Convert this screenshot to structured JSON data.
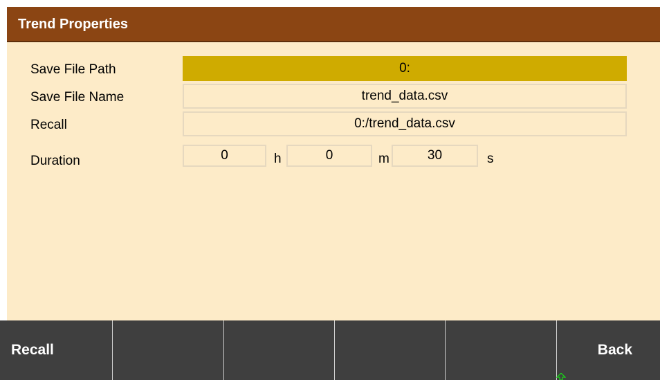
{
  "header": {
    "title": "Trend Properties"
  },
  "form": {
    "save_file_path": {
      "label": "Save File Path",
      "value": "0:"
    },
    "save_file_name": {
      "label": "Save File Name",
      "value": "trend_data.csv"
    },
    "recall": {
      "label": "Recall",
      "value": "0:/trend_data.csv"
    },
    "duration": {
      "label": "Duration",
      "hours": "0",
      "hours_unit": "h",
      "minutes": "0",
      "minutes_unit": "m",
      "seconds": "30",
      "seconds_unit": "s"
    }
  },
  "softkeys": [
    {
      "label": "Recall"
    },
    {
      "label": ""
    },
    {
      "label": ""
    },
    {
      "label": ""
    },
    {
      "label": ""
    },
    {
      "label": "Back"
    }
  ],
  "colors": {
    "title_bar": "#8b4513",
    "panel_background": "#fdebc8",
    "selected_field": "#cfab00",
    "softkey_bar": "#3f3f3f"
  },
  "icons": {
    "cursor": "mouse-cursor-icon"
  }
}
